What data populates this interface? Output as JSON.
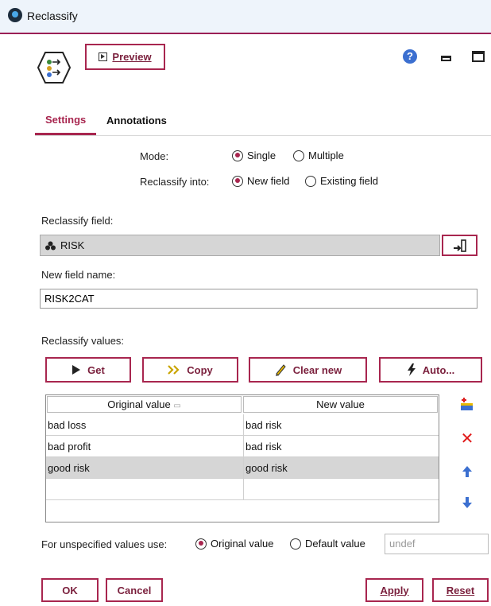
{
  "window": {
    "title": "Reclassify"
  },
  "toolbar": {
    "preview_label": "Preview"
  },
  "tabs": [
    {
      "label": "Settings",
      "active": true
    },
    {
      "label": "Annotations",
      "active": false
    }
  ],
  "mode": {
    "label": "Mode:",
    "options": [
      {
        "label": "Single",
        "selected": true
      },
      {
        "label": "Multiple",
        "selected": false
      }
    ]
  },
  "reclassify_into": {
    "label": "Reclassify into:",
    "options": [
      {
        "label": "New field",
        "selected": true
      },
      {
        "label": "Existing field",
        "selected": false
      }
    ]
  },
  "reclassify_field": {
    "label": "Reclassify field:",
    "value": "RISK",
    "icon": "set-field-icon"
  },
  "new_field_name": {
    "label": "New field name:",
    "value": "RISK2CAT"
  },
  "values_section": {
    "label": "Reclassify values:",
    "buttons": [
      {
        "label": "Get",
        "icon": "play-icon"
      },
      {
        "label": "Copy",
        "icon": "double-chevron-icon"
      },
      {
        "label": "Clear new",
        "icon": "eraser-icon"
      },
      {
        "label": "Auto...",
        "icon": "lightning-icon"
      }
    ],
    "columns": [
      "Original value",
      "New value"
    ],
    "rows": [
      {
        "original": "bad loss",
        "new": "bad risk",
        "selected": false
      },
      {
        "original": "bad profit",
        "new": "bad risk",
        "selected": false
      },
      {
        "original": "good risk",
        "new": "good risk",
        "selected": true
      }
    ]
  },
  "unspecified": {
    "label": "For unspecified values use:",
    "options": [
      {
        "label": "Original value",
        "selected": true
      },
      {
        "label": "Default value",
        "selected": false
      }
    ],
    "default_value": "undef"
  },
  "footer": {
    "ok": "OK",
    "cancel": "Cancel",
    "apply": "Apply",
    "reset": "Reset"
  },
  "colors": {
    "accent": "#a8264f",
    "selected_row": "#d6d6d6"
  }
}
